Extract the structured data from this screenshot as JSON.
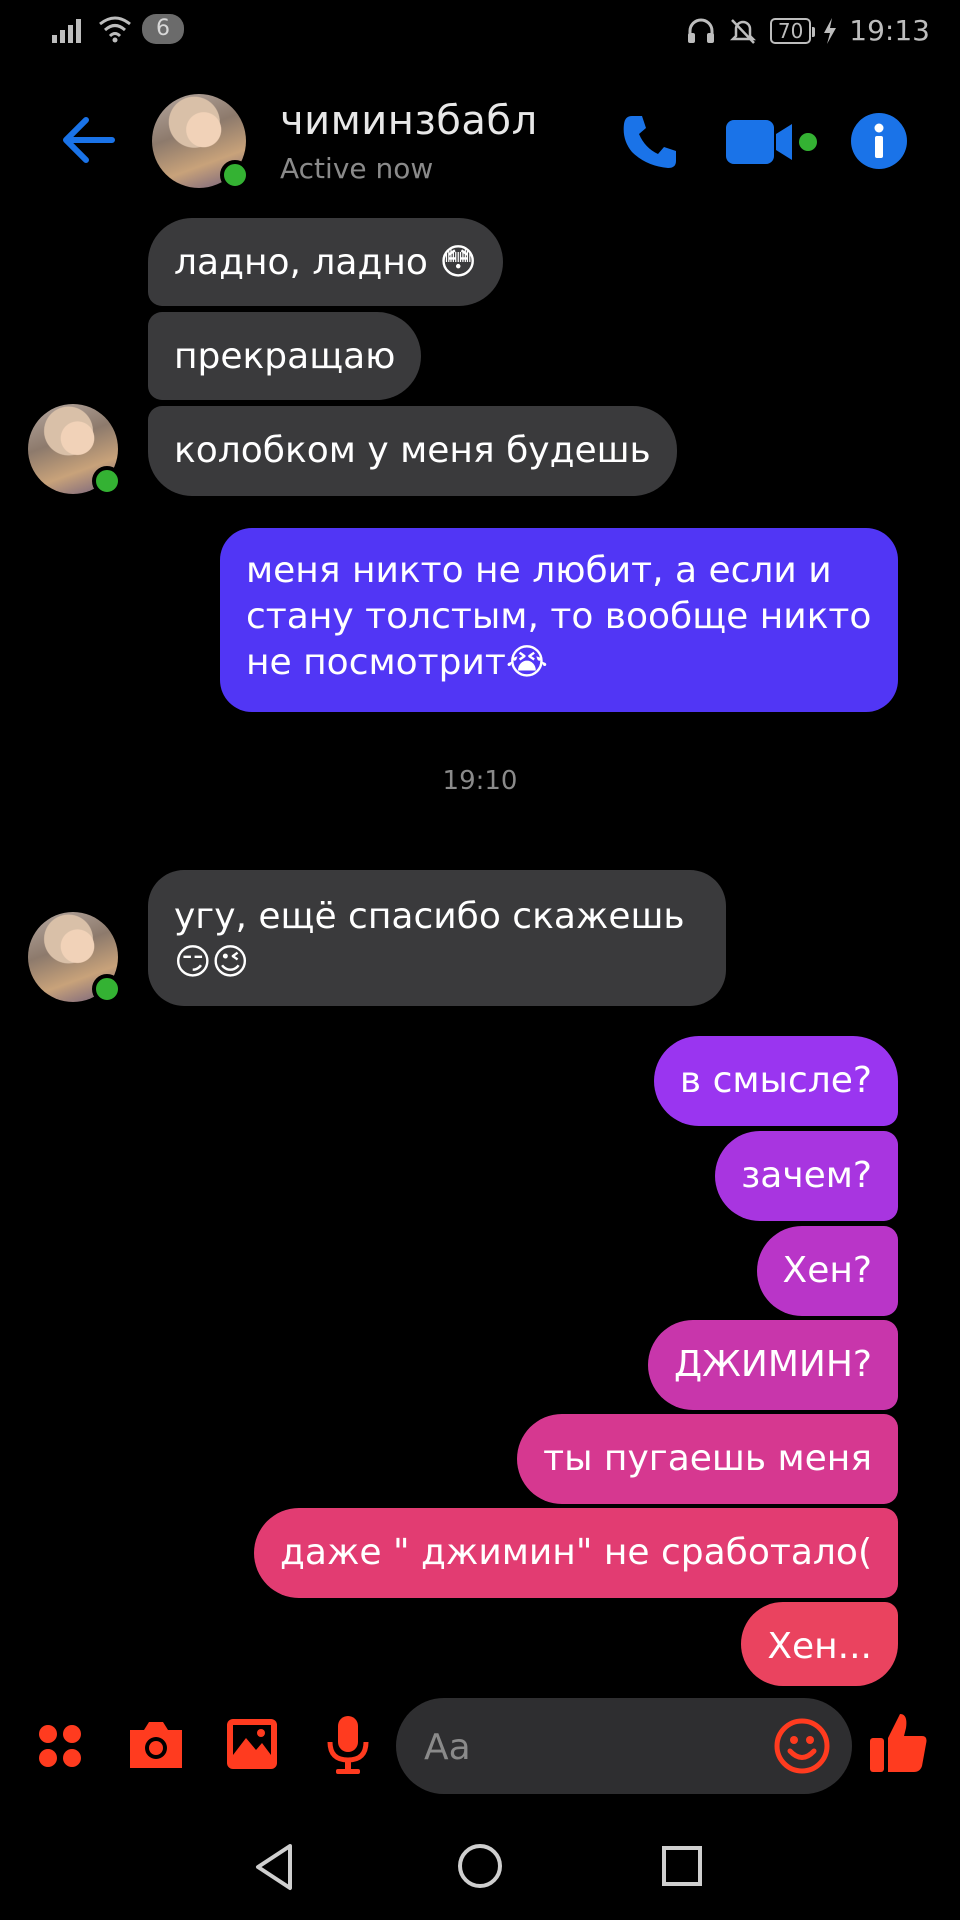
{
  "status_bar": {
    "sim_badge": "6",
    "battery": "70",
    "time": "19:13"
  },
  "header": {
    "contact_name": "чиминзбабл",
    "contact_status": "Active now",
    "icons": [
      "back-arrow-icon",
      "phone-icon",
      "video-camera-icon",
      "info-icon"
    ]
  },
  "messages": [
    {
      "dir": "in",
      "text": "ладно, ладно 😳"
    },
    {
      "dir": "in",
      "text": "прекращаю"
    },
    {
      "dir": "in",
      "text": "колобком у меня будешь"
    },
    {
      "dir": "out",
      "line1": "меня никто не любит, а если и",
      "line2": "стану толстым, то вообще никто",
      "line3": "не посмотрит😭"
    },
    {
      "dir": "in",
      "line1": "угу, ещё спасибо скажешь",
      "line2": "😏😉"
    },
    {
      "dir": "out",
      "text": "в смысле?"
    },
    {
      "dir": "out",
      "text": "зачем?"
    },
    {
      "dir": "out",
      "text": "Хен?"
    },
    {
      "dir": "out",
      "text": "ДЖИМИН?"
    },
    {
      "dir": "out",
      "text": "ты пугаешь меня"
    },
    {
      "dir": "out",
      "text": "даже \" джимин\" не сработало("
    },
    {
      "dir": "out",
      "text": "Хен..."
    }
  ],
  "timestamp": "19:10",
  "composer": {
    "placeholder": "Aa",
    "icons": [
      "apps-icon",
      "camera-icon",
      "gallery-icon",
      "microphone-icon",
      "emoji-icon",
      "thumbs-up-icon"
    ]
  },
  "colors": {
    "accent_blue": "#1a73e8",
    "composer_orange": "#ff3b1f",
    "incoming_bubble": "#3a3a3c",
    "gradient_top": "#4f3cf5",
    "gradient_bottom": "#f04b5c"
  }
}
